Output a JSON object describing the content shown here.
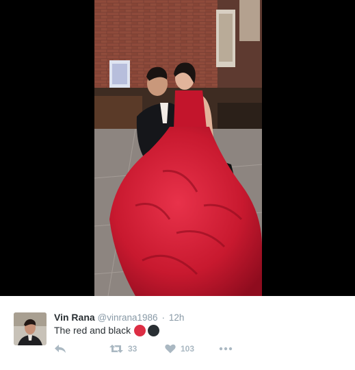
{
  "tweet": {
    "display_name": "Vin Rana",
    "handle": "@vinrana1986",
    "separator": "·",
    "time": "12h",
    "text": "The red and black",
    "emojis": [
      {
        "icon": "red-circle-icon",
        "color": "#dd2e44"
      },
      {
        "icon": "black-circle-icon",
        "color": "#292f33"
      }
    ]
  },
  "actions": {
    "reply": {
      "icon": "reply-icon"
    },
    "retweet": {
      "icon": "retweet-icon",
      "count": "33"
    },
    "like": {
      "icon": "heart-icon",
      "count": "103"
    },
    "more": {
      "icon": "more-dots-icon"
    }
  },
  "colors": {
    "name": "#292f33",
    "meta": "#8899a6",
    "action": "#aab8c2",
    "media_background": "#000000"
  }
}
